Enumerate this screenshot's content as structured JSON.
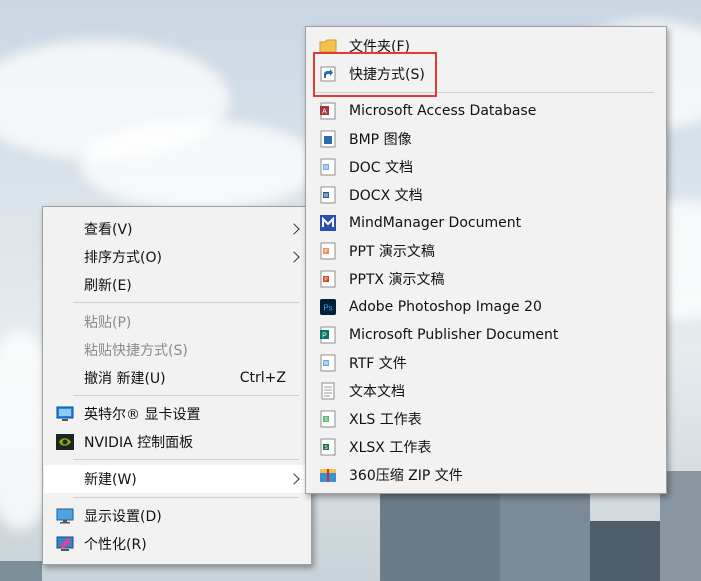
{
  "colors": {
    "highlight_box": "#e53935",
    "word": "#2b579a",
    "ppt": "#d24726",
    "excel": "#217346",
    "access": "#a4373a",
    "ps": "#31a8ff"
  },
  "left_menu": {
    "view": "查看(V)",
    "sort": "排序方式(O)",
    "refresh": "刷新(E)",
    "paste": "粘贴(P)",
    "paste_shortcut": "粘贴快捷方式(S)",
    "undo": "撤消 新建(U)",
    "undo_shortcut": "Ctrl+Z",
    "intel": "英特尔® 显卡设置",
    "nvidia": "NVIDIA 控制面板",
    "new": "新建(W)",
    "display": "显示设置(D)",
    "personalize": "个性化(R)"
  },
  "sub_menu": {
    "folder": "文件夹(F)",
    "shortcut": "快捷方式(S)",
    "items": [
      {
        "label": "Microsoft Access Database",
        "icon": "access-icon"
      },
      {
        "label": "BMP 图像",
        "icon": "bmp-icon"
      },
      {
        "label": "DOC 文档",
        "icon": "doc-icon"
      },
      {
        "label": "DOCX 文档",
        "icon": "docx-icon"
      },
      {
        "label": "MindManager Document",
        "icon": "mindmanager-icon"
      },
      {
        "label": "PPT 演示文稿",
        "icon": "ppt-icon"
      },
      {
        "label": "PPTX 演示文稿",
        "icon": "pptx-icon"
      },
      {
        "label": "Adobe Photoshop Image 20",
        "icon": "photoshop-icon"
      },
      {
        "label": "Microsoft Publisher Document",
        "icon": "publisher-icon"
      },
      {
        "label": "RTF 文件",
        "icon": "rtf-icon"
      },
      {
        "label": "文本文档",
        "icon": "text-icon"
      },
      {
        "label": "XLS 工作表",
        "icon": "xls-icon"
      },
      {
        "label": "XLSX 工作表",
        "icon": "xlsx-icon"
      },
      {
        "label": "360压缩 ZIP 文件",
        "icon": "zip-icon"
      }
    ]
  }
}
